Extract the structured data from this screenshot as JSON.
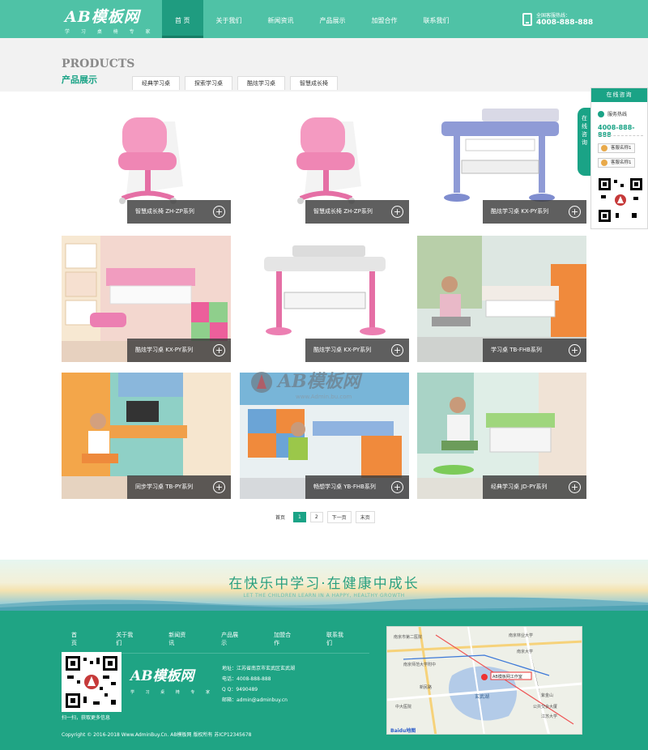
{
  "header": {
    "logo_text": "AB模板网",
    "logo_sub": "学 习 桌 椅 专 家",
    "nav": [
      "首 页",
      "关于我们",
      "新闻资讯",
      "产品展示",
      "加盟合作",
      "联系我们"
    ],
    "hotline_label": "全国客服热线：",
    "hotline_number": "4008-888-888"
  },
  "section": {
    "title_en": "PRODUCTS",
    "title_cn": "产品展示",
    "tabs": [
      "经典学习桌",
      "探索学习桌",
      "酷炫学习桌",
      "智慧成长椅"
    ]
  },
  "products": [
    {
      "caption": "智慧成长椅 ZH-ZP系列"
    },
    {
      "caption": "智慧成长椅 ZH-ZP系列"
    },
    {
      "caption": "酷炫学习桌 KX-PY系列"
    },
    {
      "caption": "酷炫学习桌 KX-PY系列"
    },
    {
      "caption": "酷炫学习桌 KX-PY系列"
    },
    {
      "caption": "学习桌 TB-FHB系列"
    },
    {
      "caption": "同步学习桌 TB-PY系列"
    },
    {
      "caption": "畅想学习桌 YB-FHB系列"
    },
    {
      "caption": "经典学习桌 JD-PY系列"
    }
  ],
  "pager": {
    "first": "首页",
    "pages": [
      "1",
      "2"
    ],
    "next": "下一页",
    "last": "末页",
    "current": "1"
  },
  "banner": {
    "slogan": "在快乐中学习·在健康中成长",
    "slogan_en": "LET THE CHILDREN LEARN IN A HAPPY, HEALTHY GROWTH"
  },
  "watermark": {
    "text": "AB模板网",
    "url": "www.Admin.bu.com"
  },
  "service": {
    "title": "在线咨询",
    "tab": "在线咨询",
    "hotline_label": "服务热线",
    "hotline": "4008-888-888",
    "qq1": "客服名称1",
    "qq2": "客服名称1"
  },
  "footer": {
    "nav": [
      "首 页",
      "关于我们",
      "新闻资讯",
      "产品展示",
      "加盟合作",
      "联系我们"
    ],
    "qr_text": "扫一扫，获取更多信息",
    "logo_text": "AB模板网",
    "logo_sub": "学 习 桌 椅 专 家",
    "address": "地址：江苏省南京市玄武区玄武湖",
    "phone": "电话：4008-888-888",
    "qq": "Q Q：9490489",
    "email": "邮箱：admin@adminbuy.cn",
    "copyright": "Copyright © 2016-2018 Www.AdminBuy.Cn. AB模板网 版权所有 苏ICP12345678",
    "map_labels": [
      "南京市第二医院",
      "南京林业大学",
      "南京师范大学附中",
      "南京大学",
      "新民路",
      "玄武湖",
      "AB模板网工作室",
      "中大医院",
      "紫金山",
      "公共交会大厦",
      "江苏大学",
      "Baidu地图"
    ]
  },
  "colors": {
    "brand": "#4fc2a6",
    "nav_active": "#1f9c80",
    "accent": "#1aa386",
    "footer": "#1fa484"
  }
}
